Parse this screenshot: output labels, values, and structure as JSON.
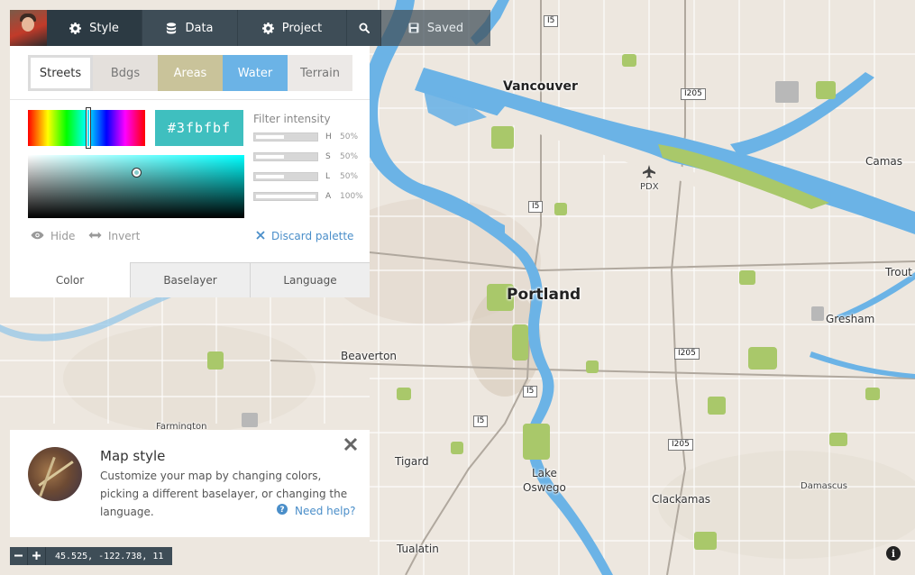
{
  "topbar": {
    "tabs": {
      "style": "Style",
      "data": "Data",
      "project": "Project",
      "saved": "Saved"
    }
  },
  "style_panel": {
    "layer_tabs": [
      "Streets",
      "Bdgs",
      "Areas",
      "Water",
      "Terrain"
    ],
    "selected_layer": "Streets",
    "color_hex": "#3fbfbf",
    "filter": {
      "title": "Filter intensity",
      "rows": [
        {
          "key": "H",
          "value": "50%",
          "level": 0.5
        },
        {
          "key": "S",
          "value": "50%",
          "level": 0.5
        },
        {
          "key": "L",
          "value": "50%",
          "level": 0.5
        },
        {
          "key": "A",
          "value": "100%",
          "level": 1.0
        }
      ]
    },
    "actions": {
      "hide": "Hide",
      "invert": "Invert",
      "discard": "Discard palette"
    },
    "bottom_tabs": [
      "Color",
      "Baselayer",
      "Language"
    ],
    "selected_bottom_tab": "Color"
  },
  "help_card": {
    "title": "Map style",
    "text": "Customize your map by changing colors, picking a different baselayer, or changing the language.",
    "help_link": "Need help?"
  },
  "map": {
    "coords": "45.525, -122.738, 11",
    "labels": {
      "vancouver": "Vancouver",
      "portland": "Portland",
      "camas": "Camas",
      "troutdale": "Trout",
      "gresham": "Gresham",
      "beaverton": "Beaverton",
      "farmington": "Farmington",
      "tigard": "Tigard",
      "lake": "Lake",
      "oswego": "Oswego",
      "clackamas": "Clackamas",
      "damascus": "Damascus",
      "tualatin": "Tualatin",
      "pdx": "PDX"
    },
    "shields": {
      "i5_top": "I5",
      "i205_top": "I205",
      "i5_mid": "I5",
      "i5_low": "I5",
      "i5_bottom": "I5",
      "i205_mid": "I205",
      "i205_low": "I205"
    }
  },
  "colors": {
    "water": "#6bb3e6",
    "park": "#a9c86a",
    "land": "#ede7df",
    "toolbar": "#3e4d57",
    "accent": "#3fbfbf",
    "link": "#4a8ec9"
  }
}
